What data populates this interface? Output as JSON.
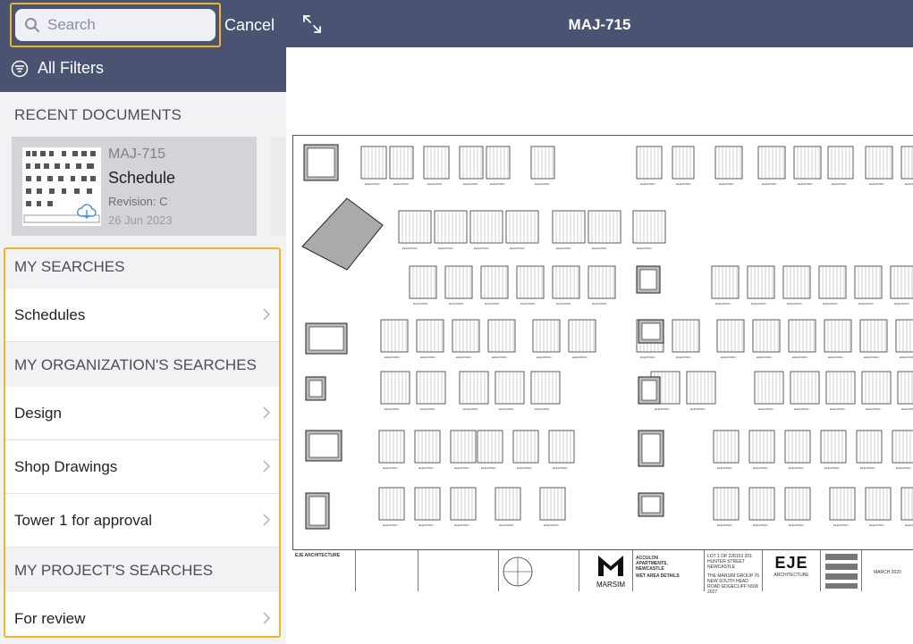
{
  "search": {
    "placeholder": "Search",
    "cancel_label": "Cancel"
  },
  "filters": {
    "label": "All Filters"
  },
  "recent": {
    "heading": "RECENT DOCUMENTS",
    "card": {
      "code": "MAJ-715",
      "title": "Schedule",
      "revision": "Revision: C",
      "date": "26 Jun 2023"
    }
  },
  "groups": [
    {
      "heading": "MY SEARCHES",
      "items": [
        "Schedules"
      ]
    },
    {
      "heading": "MY ORGANIZATION'S SEARCHES",
      "items": [
        "Design",
        "Shop Drawings",
        "Tower 1 for approval"
      ]
    },
    {
      "heading": "MY PROJECT'S SEARCHES",
      "items": [
        "For review"
      ]
    }
  ],
  "viewer": {
    "title": "MAJ-715"
  },
  "drawing": {
    "firm_left": "EJE ARCHITECTURE",
    "client_logo": "MARSIM",
    "project": "ACCULON APARTMENTS, NEWCASTLE",
    "sheet_name": "WET AREA DETAILS",
    "address": "LOT 1 DP 228153 201 HUNTER STREET NEWCASTLE",
    "owner": "THE MARSIM GROUP 76 NEW SOUTH HEAD ROAD EDGECLIFF NSW 2027",
    "firm_logo": "EJE",
    "firm_sub": "ARCHITECTURE",
    "date_small": "MARCH 2020",
    "elevation_label": "ELEVATION"
  },
  "colors": {
    "header": "#4a5372",
    "highlight": "#f0b429",
    "sidebar": "#f2f2f4",
    "card": "#d3d4d7"
  }
}
